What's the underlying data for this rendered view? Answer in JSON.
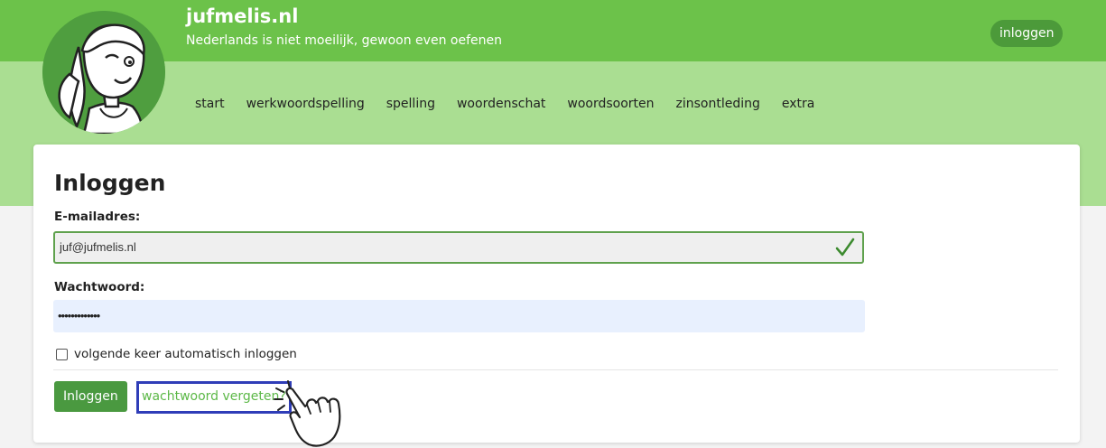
{
  "site": {
    "title": "jufmelis.nl",
    "tagline": "Nederlands is niet moeilijk, gewoon even oefenen",
    "logo_icon": "girl-illustration-logo"
  },
  "header": {
    "login_button": "inloggen"
  },
  "nav": {
    "items": [
      "start",
      "werkwoordspelling",
      "spelling",
      "woordenschat",
      "woordsoorten",
      "zinsontleding",
      "extra"
    ]
  },
  "form": {
    "title": "Inloggen",
    "email_label": "E-mailadres:",
    "email_value": "juf@jufmelis.nl",
    "email_valid_icon": "checkmark-icon",
    "password_label": "Wachtwoord:",
    "password_value": "•••••••••••••",
    "remember_label": "volgende keer automatisch inloggen",
    "remember_checked": false,
    "submit_label": "Inloggen",
    "forgot_link": "wachtwoord vergeten?"
  },
  "cursor": {
    "icon": "pointing-hand-click-icon"
  },
  "colors": {
    "header_green": "#6cc24a",
    "nav_band_green": "#aade92",
    "button_green": "#4a9940",
    "link_green": "#5cb847",
    "highlight_blue": "#2f3db8",
    "autofill_blue": "#e8f0fe"
  }
}
